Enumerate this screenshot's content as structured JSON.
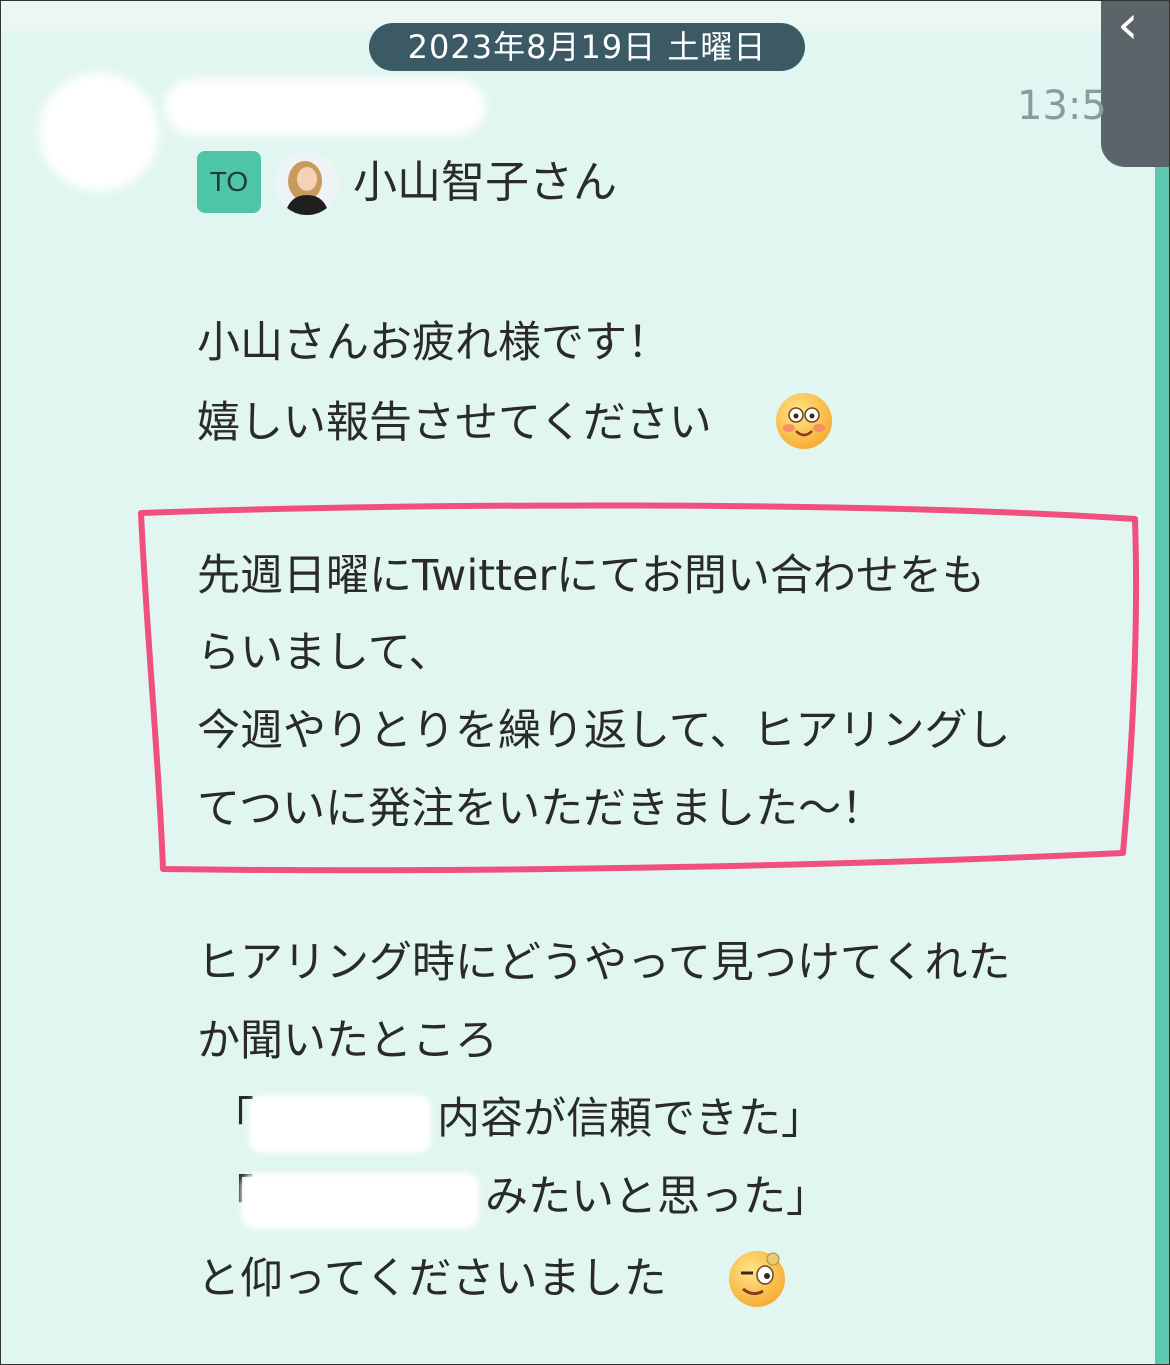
{
  "header": {
    "date": "2023年8月19日 土曜日",
    "time": "13:5",
    "back_icon": "chevron-left-icon"
  },
  "message": {
    "to_badge": "TO",
    "to_name": "小山智子さん",
    "lines": [
      "小山さんお疲れ様です！",
      "嬉しい報告させてください",
      "先週日曜にTwitterにてお問い合わせをも",
      "らいまして、",
      "今週やりとりを繰り返して、ヒアリングし",
      "てついに発注をいただきました〜！",
      "ヒアリング時にどうやって見つけてくれた",
      "か聞いたところ",
      "「",
      "内容が信頼できた」",
      "「",
      "みたいと思った」",
      "と仰ってくださいました"
    ],
    "emoji_1": "smiling-face-icon",
    "emoji_2": "winking-face-icon"
  },
  "colors": {
    "background": "#e2f6f1",
    "accent": "#4fc5a8",
    "date_pill": "#3b5a66",
    "highlight": "#f0507e"
  }
}
